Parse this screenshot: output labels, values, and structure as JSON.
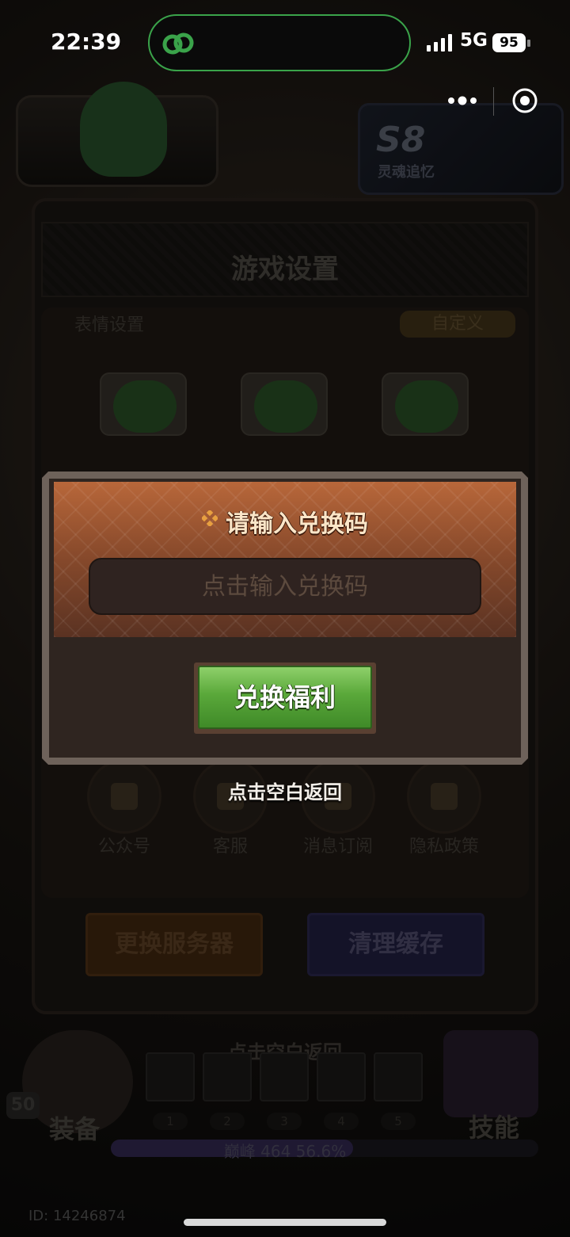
{
  "status_bar": {
    "time": "22:39",
    "network": "5G",
    "battery": "95",
    "accent_color": "#3aa34a"
  },
  "capsule": {
    "more_icon": "more-dots-icon",
    "close_icon": "target-circle-icon"
  },
  "season": {
    "title": "S8",
    "subtitle": "灵魂追忆"
  },
  "settings_panel": {
    "title": "游戏设置",
    "section_left": "表情设置",
    "section_right": "自定义",
    "round_buttons": [
      {
        "label": "公众号",
        "icon": "wechat-icon"
      },
      {
        "label": "客服",
        "icon": "headset-icon"
      },
      {
        "label": "消息订阅",
        "icon": "bell-icon"
      },
      {
        "label": "隐私政策",
        "icon": "document-icon"
      }
    ],
    "change_server": "更换服务器",
    "clear_cache": "清理缓存"
  },
  "modal": {
    "title": "请输入兑换码",
    "input_placeholder": "点击输入兑换码",
    "input_value": "",
    "redeem_button": "兑换福利",
    "tap_blank_return": "点击空白返回",
    "title_color": "#fbe6c8",
    "button_color": "#5aa83a"
  },
  "hud": {
    "tap_blank_return": "点击空白返回",
    "level": "50",
    "equip_label": "装备",
    "skill_label": "技能",
    "slot_numbers": [
      "1",
      "2",
      "3",
      "4",
      "5"
    ],
    "progress_text": "巅峰 464  56.6%",
    "progress_fraction": 0.566,
    "player_id": "ID: 14246874"
  }
}
